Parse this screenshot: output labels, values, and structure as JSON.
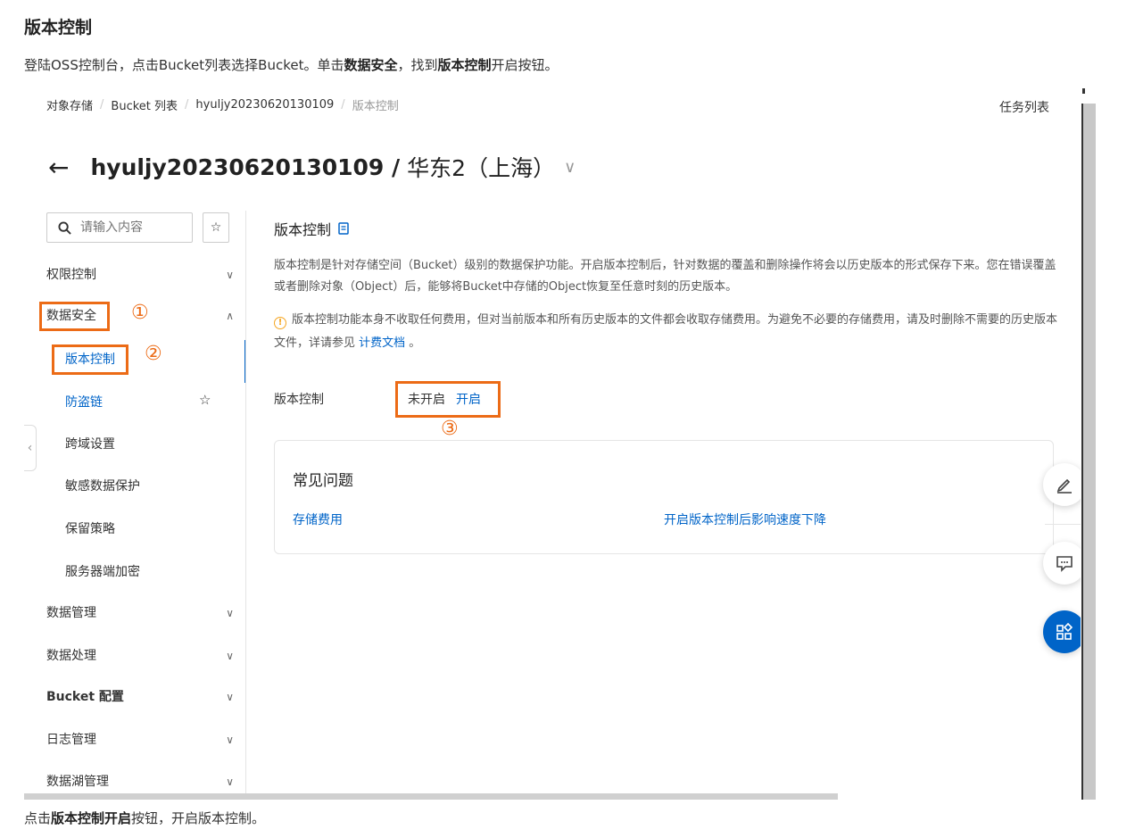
{
  "doc": {
    "title": "版本控制",
    "intro_1": "登陆OSS控制台，点击Bucket列表选择Bucket。单击",
    "intro_bold_1": "数据安全",
    "intro_2": "，找到",
    "intro_bold_2": "版本控制",
    "intro_3": "开启按钮。",
    "outro_1": "点击",
    "outro_bold": "版本控制开启",
    "outro_2": "按钮，开启版本控制。"
  },
  "breadcrumb": [
    "对象存储",
    "Bucket 列表",
    "hyuljy20230620130109",
    "版本控制"
  ],
  "header": {
    "task_list": "任务列表",
    "back": "←",
    "bucket_name": "hyuljy20230620130109 /",
    "region": "华东2（上海）",
    "region_chevron": "∨"
  },
  "sidebar": {
    "search_placeholder": "请输入内容",
    "items": [
      {
        "label": "权限控制",
        "chevron": "∨"
      },
      {
        "label": "数据安全",
        "chevron": "∧"
      },
      {
        "label": "数据管理",
        "chevron": "∨"
      },
      {
        "label": "数据处理",
        "chevron": "∨"
      },
      {
        "label": "Bucket 配置",
        "chevron": "∨"
      },
      {
        "label": "日志管理",
        "chevron": "∨"
      },
      {
        "label": "数据湖管理",
        "chevron": "∨"
      }
    ],
    "sub_items": [
      "版本控制",
      "防盗链",
      "跨域设置",
      "敏感数据保护",
      "保留策略",
      "服务器端加密"
    ]
  },
  "annotations": {
    "step1": "①",
    "step2": "②",
    "step3": "③"
  },
  "main": {
    "section_title": "版本控制",
    "description": "版本控制是针对存储空间（Bucket）级别的数据保护功能。开启版本控制后，针对数据的覆盖和删除操作将会以历史版本的形式保存下来。您在错误覆盖或者删除对象（Object）后，能够将Bucket中存储的Object恢复至任意时刻的历史版本。",
    "warning_text": "版本控制功能本身不收取任何费用，但对当前版本和所有历史版本的文件都会收取存储费用。为避免不必要的存储费用，请及时删除不需要的历史版本文件，详请参见 ",
    "warning_link": "计费文档",
    "warning_end": " 。",
    "field_label": "版本控制",
    "status": "未开启",
    "enable_label": "开启"
  },
  "faq": {
    "title": "常见问题",
    "links": [
      "存储费用",
      "开启版本控制后影响速度下降"
    ]
  },
  "colors": {
    "accent": "#0064c8",
    "annotation": "#ec6b16",
    "warning": "#f5a623"
  }
}
